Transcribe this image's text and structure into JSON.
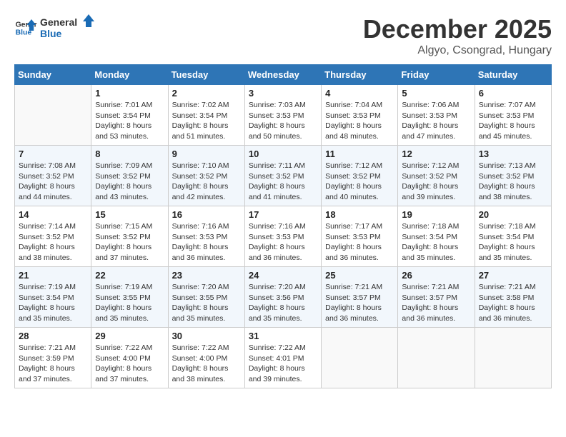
{
  "logo": {
    "line1": "General",
    "line2": "Blue"
  },
  "title": "December 2025",
  "location": "Algyo, Csongrad, Hungary",
  "weekdays": [
    "Sunday",
    "Monday",
    "Tuesday",
    "Wednesday",
    "Thursday",
    "Friday",
    "Saturday"
  ],
  "weeks": [
    [
      {
        "day": "",
        "sunrise": "",
        "sunset": "",
        "daylight": ""
      },
      {
        "day": "1",
        "sunrise": "Sunrise: 7:01 AM",
        "sunset": "Sunset: 3:54 PM",
        "daylight": "Daylight: 8 hours and 53 minutes."
      },
      {
        "day": "2",
        "sunrise": "Sunrise: 7:02 AM",
        "sunset": "Sunset: 3:54 PM",
        "daylight": "Daylight: 8 hours and 51 minutes."
      },
      {
        "day": "3",
        "sunrise": "Sunrise: 7:03 AM",
        "sunset": "Sunset: 3:53 PM",
        "daylight": "Daylight: 8 hours and 50 minutes."
      },
      {
        "day": "4",
        "sunrise": "Sunrise: 7:04 AM",
        "sunset": "Sunset: 3:53 PM",
        "daylight": "Daylight: 8 hours and 48 minutes."
      },
      {
        "day": "5",
        "sunrise": "Sunrise: 7:06 AM",
        "sunset": "Sunset: 3:53 PM",
        "daylight": "Daylight: 8 hours and 47 minutes."
      },
      {
        "day": "6",
        "sunrise": "Sunrise: 7:07 AM",
        "sunset": "Sunset: 3:53 PM",
        "daylight": "Daylight: 8 hours and 45 minutes."
      }
    ],
    [
      {
        "day": "7",
        "sunrise": "Sunrise: 7:08 AM",
        "sunset": "Sunset: 3:52 PM",
        "daylight": "Daylight: 8 hours and 44 minutes."
      },
      {
        "day": "8",
        "sunrise": "Sunrise: 7:09 AM",
        "sunset": "Sunset: 3:52 PM",
        "daylight": "Daylight: 8 hours and 43 minutes."
      },
      {
        "day": "9",
        "sunrise": "Sunrise: 7:10 AM",
        "sunset": "Sunset: 3:52 PM",
        "daylight": "Daylight: 8 hours and 42 minutes."
      },
      {
        "day": "10",
        "sunrise": "Sunrise: 7:11 AM",
        "sunset": "Sunset: 3:52 PM",
        "daylight": "Daylight: 8 hours and 41 minutes."
      },
      {
        "day": "11",
        "sunrise": "Sunrise: 7:12 AM",
        "sunset": "Sunset: 3:52 PM",
        "daylight": "Daylight: 8 hours and 40 minutes."
      },
      {
        "day": "12",
        "sunrise": "Sunrise: 7:12 AM",
        "sunset": "Sunset: 3:52 PM",
        "daylight": "Daylight: 8 hours and 39 minutes."
      },
      {
        "day": "13",
        "sunrise": "Sunrise: 7:13 AM",
        "sunset": "Sunset: 3:52 PM",
        "daylight": "Daylight: 8 hours and 38 minutes."
      }
    ],
    [
      {
        "day": "14",
        "sunrise": "Sunrise: 7:14 AM",
        "sunset": "Sunset: 3:52 PM",
        "daylight": "Daylight: 8 hours and 38 minutes."
      },
      {
        "day": "15",
        "sunrise": "Sunrise: 7:15 AM",
        "sunset": "Sunset: 3:52 PM",
        "daylight": "Daylight: 8 hours and 37 minutes."
      },
      {
        "day": "16",
        "sunrise": "Sunrise: 7:16 AM",
        "sunset": "Sunset: 3:53 PM",
        "daylight": "Daylight: 8 hours and 36 minutes."
      },
      {
        "day": "17",
        "sunrise": "Sunrise: 7:16 AM",
        "sunset": "Sunset: 3:53 PM",
        "daylight": "Daylight: 8 hours and 36 minutes."
      },
      {
        "day": "18",
        "sunrise": "Sunrise: 7:17 AM",
        "sunset": "Sunset: 3:53 PM",
        "daylight": "Daylight: 8 hours and 36 minutes."
      },
      {
        "day": "19",
        "sunrise": "Sunrise: 7:18 AM",
        "sunset": "Sunset: 3:54 PM",
        "daylight": "Daylight: 8 hours and 35 minutes."
      },
      {
        "day": "20",
        "sunrise": "Sunrise: 7:18 AM",
        "sunset": "Sunset: 3:54 PM",
        "daylight": "Daylight: 8 hours and 35 minutes."
      }
    ],
    [
      {
        "day": "21",
        "sunrise": "Sunrise: 7:19 AM",
        "sunset": "Sunset: 3:54 PM",
        "daylight": "Daylight: 8 hours and 35 minutes."
      },
      {
        "day": "22",
        "sunrise": "Sunrise: 7:19 AM",
        "sunset": "Sunset: 3:55 PM",
        "daylight": "Daylight: 8 hours and 35 minutes."
      },
      {
        "day": "23",
        "sunrise": "Sunrise: 7:20 AM",
        "sunset": "Sunset: 3:55 PM",
        "daylight": "Daylight: 8 hours and 35 minutes."
      },
      {
        "day": "24",
        "sunrise": "Sunrise: 7:20 AM",
        "sunset": "Sunset: 3:56 PM",
        "daylight": "Daylight: 8 hours and 35 minutes."
      },
      {
        "day": "25",
        "sunrise": "Sunrise: 7:21 AM",
        "sunset": "Sunset: 3:57 PM",
        "daylight": "Daylight: 8 hours and 36 minutes."
      },
      {
        "day": "26",
        "sunrise": "Sunrise: 7:21 AM",
        "sunset": "Sunset: 3:57 PM",
        "daylight": "Daylight: 8 hours and 36 minutes."
      },
      {
        "day": "27",
        "sunrise": "Sunrise: 7:21 AM",
        "sunset": "Sunset: 3:58 PM",
        "daylight": "Daylight: 8 hours and 36 minutes."
      }
    ],
    [
      {
        "day": "28",
        "sunrise": "Sunrise: 7:21 AM",
        "sunset": "Sunset: 3:59 PM",
        "daylight": "Daylight: 8 hours and 37 minutes."
      },
      {
        "day": "29",
        "sunrise": "Sunrise: 7:22 AM",
        "sunset": "Sunset: 4:00 PM",
        "daylight": "Daylight: 8 hours and 37 minutes."
      },
      {
        "day": "30",
        "sunrise": "Sunrise: 7:22 AM",
        "sunset": "Sunset: 4:00 PM",
        "daylight": "Daylight: 8 hours and 38 minutes."
      },
      {
        "day": "31",
        "sunrise": "Sunrise: 7:22 AM",
        "sunset": "Sunset: 4:01 PM",
        "daylight": "Daylight: 8 hours and 39 minutes."
      },
      {
        "day": "",
        "sunrise": "",
        "sunset": "",
        "daylight": ""
      },
      {
        "day": "",
        "sunrise": "",
        "sunset": "",
        "daylight": ""
      },
      {
        "day": "",
        "sunrise": "",
        "sunset": "",
        "daylight": ""
      }
    ]
  ]
}
